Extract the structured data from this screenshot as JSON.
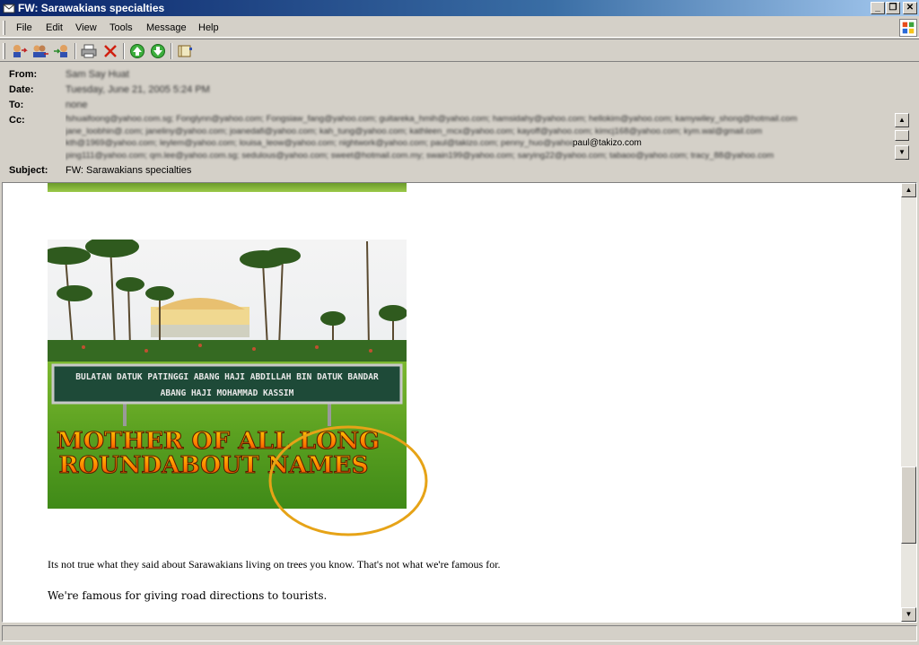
{
  "window": {
    "title": "FW: Sarawakians specialties",
    "min_glyph": "_",
    "restore_glyph": "❐",
    "close_glyph": "✕"
  },
  "menu": [
    "File",
    "Edit",
    "View",
    "Tools",
    "Message",
    "Help"
  ],
  "toolbar": {
    "icons": [
      "reply-icon",
      "reply-all-icon",
      "forward-icon",
      "print-icon",
      "delete-icon",
      "previous-icon",
      "next-icon",
      "address-book-icon"
    ]
  },
  "header": {
    "from_label": "From:",
    "date_label": "Date:",
    "to_label": "To:",
    "cc_label": "Cc:",
    "subject_label": "Subject:",
    "from_value": "Sam Say Huat",
    "date_value": "Tuesday, June 21, 2005 5:24 PM",
    "to_value": "none",
    "cc_lines": [
      "fshuaifoong@yahoo.com.sg; Fonglynn@yahoo.com; Fongsiaw_fang@yahoo.com; guitareka_hmih@yahoo.com; hamsidahy@yahoo.com; hellokim@yahoo.com; kamywiley_shong@hotmail.com",
      "jane_loobhin@.com; janeliny@yahoo.com; joanedafi@yahoo.com; kah_tung@yahoo.com; kathleen_mcx@yahoo.com; kayoff@yahoo.com; kimcj168@yahoo.com; kym.wal@gmail.com",
      "kth@1969@yahoo.com; leylem@yahoo.com; louisa_leow@yahoo.com; nightwork@yahoo.com; paul@takizo.com; penny_huo@yahoo.com",
      "ping111@yahoo.com; qm.lee@yahoo.com.sg; sedulous@yahoo.com; sweet@hotmail.com.my; swain199@yahoo.com; sarying22@yahoo.com; tabaoo@yahoo.com; tracy_88@yahoo.com"
    ],
    "cc_visible_address": "paul@takizo.com",
    "subject_value": "FW: Sarawakians specialties"
  },
  "message": {
    "sign_line1": "BULATAN DATUK PATINGGI ABANG HAJI ABDILLAH BIN DATUK BANDAR",
    "sign_line2": "ABANG HAJI MOHAMMAD KASSIM",
    "caption_line1": "MOTHER OF ALL LONG",
    "caption_line2": "ROUNDABOUT NAMES",
    "paragraph1": "Its not true what they said about Sarawakians living on trees you know. That's not what we're famous for.",
    "paragraph2": "We're famous for giving road directions to tourists."
  },
  "colors": {
    "titlebar_start": "#0a246a",
    "titlebar_end": "#a6caf0",
    "chrome": "#d4d0c8",
    "highlight_circle": "#e6a317",
    "caption_fill": "#ff7a00"
  }
}
